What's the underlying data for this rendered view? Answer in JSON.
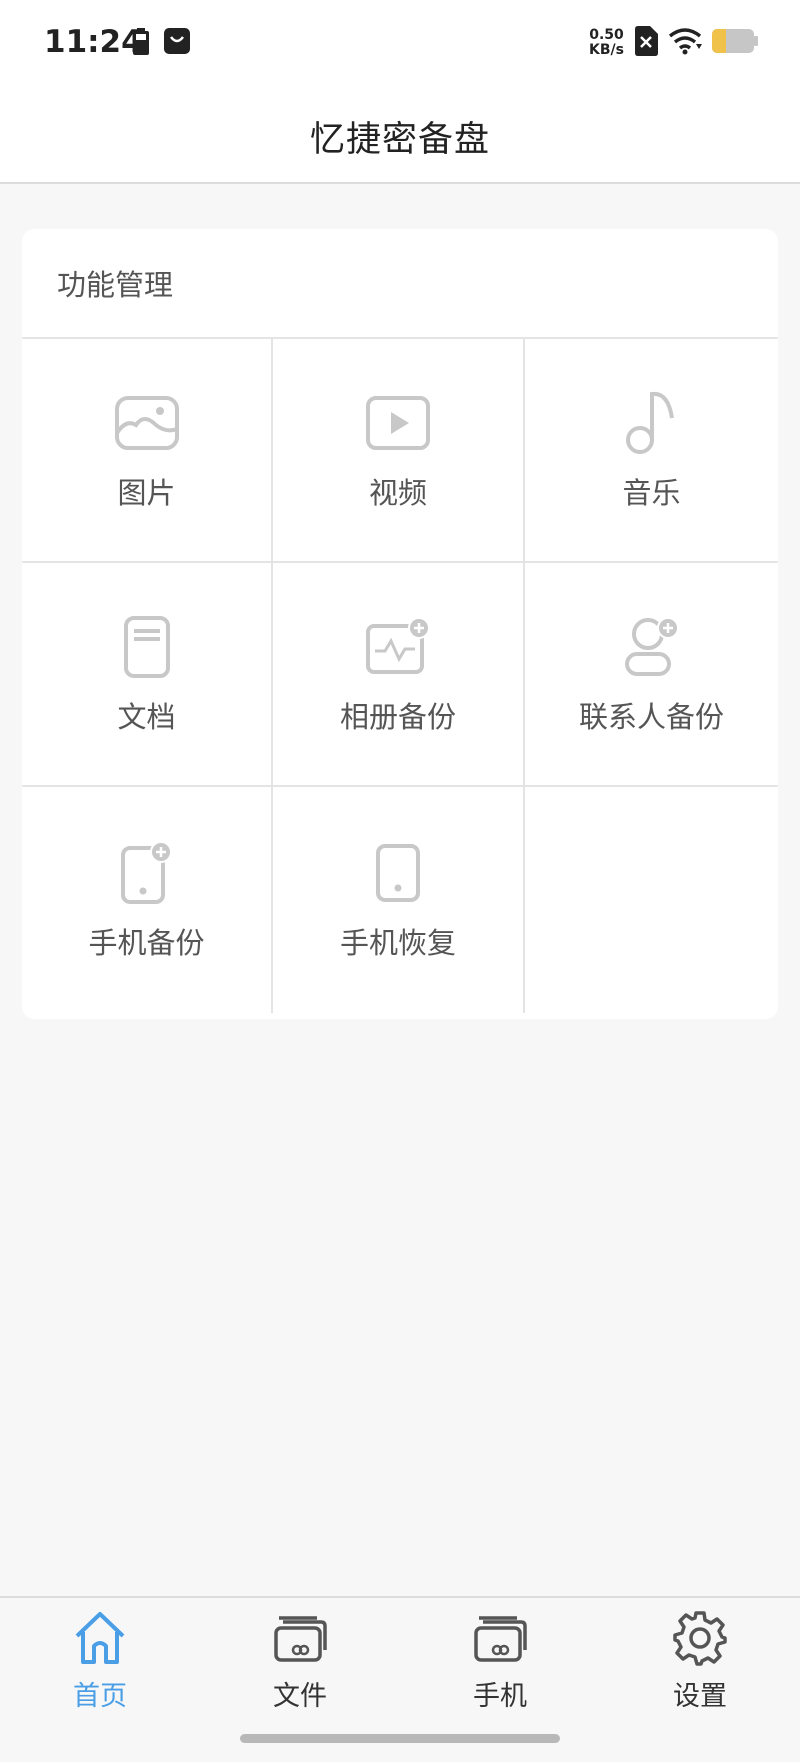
{
  "status_bar": {
    "time": "11:24",
    "speed_value": "0.50",
    "speed_unit": "KB/s"
  },
  "app": {
    "title": "忆捷密备盘"
  },
  "function_panel": {
    "title": "功能管理",
    "items": [
      {
        "label": "图片",
        "icon": "image-icon"
      },
      {
        "label": "视频",
        "icon": "video-play-icon"
      },
      {
        "label": "音乐",
        "icon": "music-note-icon"
      },
      {
        "label": "文档",
        "icon": "document-icon"
      },
      {
        "label": "相册备份",
        "icon": "album-backup-icon"
      },
      {
        "label": "联系人备份",
        "icon": "contact-backup-icon"
      },
      {
        "label": "手机备份",
        "icon": "phone-backup-icon"
      },
      {
        "label": "手机恢复",
        "icon": "phone-restore-icon"
      }
    ]
  },
  "bottom_nav": {
    "items": [
      {
        "label": "首页",
        "icon": "home-icon",
        "active": true
      },
      {
        "label": "文件",
        "icon": "files-icon",
        "active": false
      },
      {
        "label": "手机",
        "icon": "phone-storage-icon",
        "active": false
      },
      {
        "label": "设置",
        "icon": "gear-icon",
        "active": false
      }
    ]
  },
  "colors": {
    "accent": "#4a9ee6",
    "icon_gray": "#c8c8c8",
    "text": "#555555",
    "background": "#f7f7f7"
  }
}
